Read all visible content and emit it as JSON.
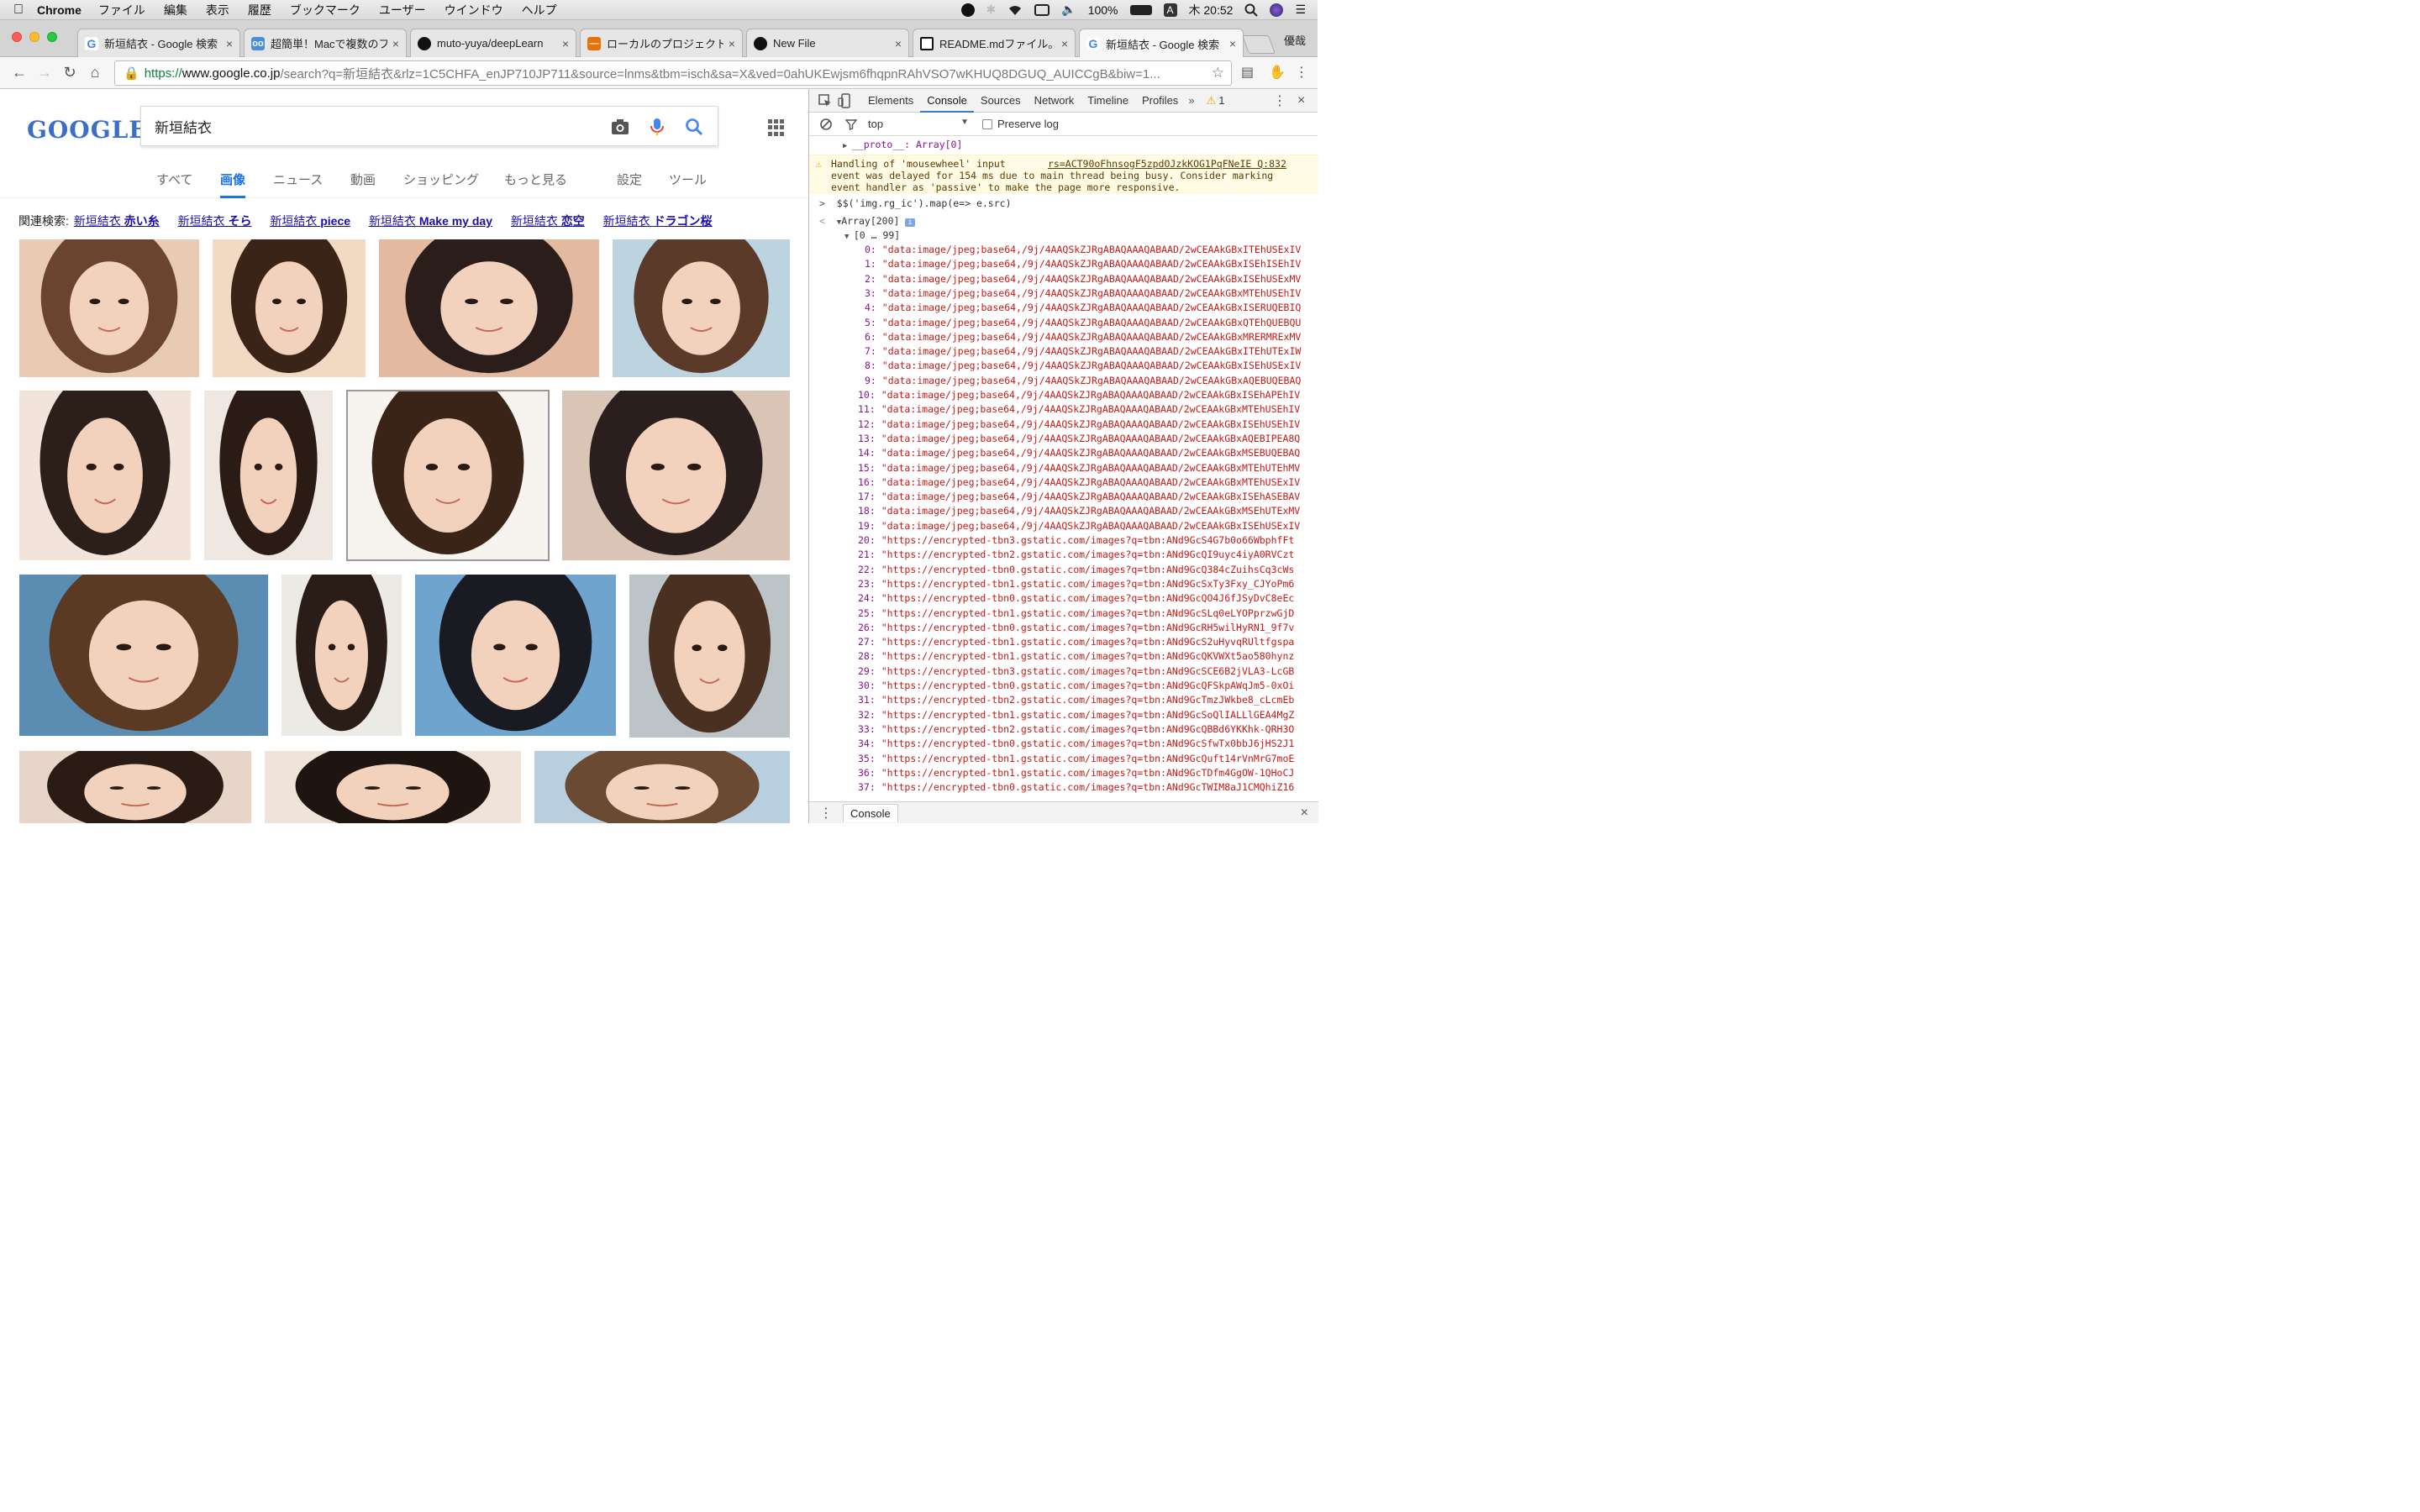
{
  "menubar": {
    "app": "Chrome",
    "items": [
      "ファイル",
      "編集",
      "表示",
      "履歴",
      "ブックマーク",
      "ユーザー",
      "ウインドウ",
      "ヘルプ"
    ],
    "battery": "100%",
    "input_method": "A",
    "clock": "木 20:52"
  },
  "tabs": [
    {
      "title": "新垣結衣 - Google 検索",
      "icon": "google-icon"
    },
    {
      "title": "超簡単！Macで複数のフ",
      "icon": "glasses-icon"
    },
    {
      "title": "muto-yuya/deepLearn",
      "icon": "github-icon"
    },
    {
      "title": "ローカルのプロジェクト",
      "icon": "qiita-icon"
    },
    {
      "title": "New File",
      "icon": "github-icon"
    },
    {
      "title": "README.mdファイル。",
      "icon": "page-icon"
    },
    {
      "title": "新垣結衣 - Google 検索",
      "icon": "google-icon"
    }
  ],
  "profile_name": "優哉",
  "address": {
    "scheme": "https://",
    "host": "www.google.co.jp",
    "path": "/search?q=新垣結衣&rlz=1C5CHFA_enJP710JP711&source=lnms&tbm=isch&sa=X&ved=0ahUKEwjsm6fhqpnRAhVSO7wKHUQ8DGUQ_AUICCgB&biw=1..."
  },
  "google": {
    "logo": "GOOGLE",
    "query": "新垣結衣",
    "tabs": [
      "すべて",
      "画像",
      "ニュース",
      "動画",
      "ショッピング",
      "もっと見る",
      "設定",
      "ツール"
    ],
    "active_tab": "画像",
    "related_label": "関連検索:",
    "related": [
      {
        "q": "新垣結衣",
        "extra": "赤い糸"
      },
      {
        "q": "新垣結衣",
        "extra": "そら"
      },
      {
        "q": "新垣結衣",
        "extra": "piece"
      },
      {
        "q": "新垣結衣",
        "extra": "Make my day"
      },
      {
        "q": "新垣結衣",
        "extra": "恋空"
      },
      {
        "q": "新垣結衣",
        "extra": "ドラゴン桜"
      }
    ]
  },
  "devtools": {
    "tabs": [
      "Elements",
      "Console",
      "Sources",
      "Network",
      "Timeline",
      "Profiles"
    ],
    "active_tab": "Console",
    "warning_count": "1",
    "context": "top",
    "preserve_log": "Preserve log",
    "proto_line": "__proto__: Array[0]",
    "warning_line1": "Handling of 'mousewheel' input",
    "warning_source": "rs=ACT90oFhnsogF5zpdOJzkKOG1PqFNeIE Q:832",
    "warning_line2": "event was delayed for 154 ms due to main thread being busy. Consider marking",
    "warning_line3": "event handler as 'passive' to make the page more responsive.",
    "command": "$$('img.rg_ic').map(e=> e.src)",
    "result": "Array[200]",
    "range": "[0 … 99]",
    "entries": [
      "\"data:image/jpeg;base64,/9j/4AAQSkZJRgABAQAAAQABAAD/2wCEAAkGBxITEhUSExIV",
      "\"data:image/jpeg;base64,/9j/4AAQSkZJRgABAQAAAQABAAD/2wCEAAkGBxISEhISEhIV",
      "\"data:image/jpeg;base64,/9j/4AAQSkZJRgABAQAAAQABAAD/2wCEAAkGBxISEhUSExMV",
      "\"data:image/jpeg;base64,/9j/4AAQSkZJRgABAQAAAQABAAD/2wCEAAkGBxMTEhUSEhIV",
      "\"data:image/jpeg;base64,/9j/4AAQSkZJRgABAQAAAQABAAD/2wCEAAkGBxISERUQEBIQ",
      "\"data:image/jpeg;base64,/9j/4AAQSkZJRgABAQAAAQABAAD/2wCEAAkGBxQTEhQUEBQU",
      "\"data:image/jpeg;base64,/9j/4AAQSkZJRgABAQAAAQABAAD/2wCEAAkGBxMRERMRExMV",
      "\"data:image/jpeg;base64,/9j/4AAQSkZJRgABAQAAAQABAAD/2wCEAAkGBxITEhUTExIW",
      "\"data:image/jpeg;base64,/9j/4AAQSkZJRgABAQAAAQABAAD/2wCEAAkGBxISEhUSExIV",
      "\"data:image/jpeg;base64,/9j/4AAQSkZJRgABAQAAAQABAAD/2wCEAAkGBxAQEBUQEBAQ",
      "\"data:image/jpeg;base64,/9j/4AAQSkZJRgABAQAAAQABAAD/2wCEAAkGBxISEhAPEhIV",
      "\"data:image/jpeg;base64,/9j/4AAQSkZJRgABAQAAAQABAAD/2wCEAAkGBxMTEhUSEhIV",
      "\"data:image/jpeg;base64,/9j/4AAQSkZJRgABAQAAAQABAAD/2wCEAAkGBxISEhUSEhIV",
      "\"data:image/jpeg;base64,/9j/4AAQSkZJRgABAQAAAQABAAD/2wCEAAkGBxAQEBIPEA8Q",
      "\"data:image/jpeg;base64,/9j/4AAQSkZJRgABAQAAAQABAAD/2wCEAAkGBxMSEBUQEBAQ",
      "\"data:image/jpeg;base64,/9j/4AAQSkZJRgABAQAAAQABAAD/2wCEAAkGBxMTEhUTEhMV",
      "\"data:image/jpeg;base64,/9j/4AAQSkZJRgABAQAAAQABAAD/2wCEAAkGBxMTEhUSExIV",
      "\"data:image/jpeg;base64,/9j/4AAQSkZJRgABAQAAAQABAAD/2wCEAAkGBxISEhASEBAV",
      "\"data:image/jpeg;base64,/9j/4AAQSkZJRgABAQAAAQABAAD/2wCEAAkGBxMSEhUTExMV",
      "\"data:image/jpeg;base64,/9j/4AAQSkZJRgABAQAAAQABAAD/2wCEAAkGBxISEhUSExIV",
      "\"https://encrypted-tbn3.gstatic.com/images?q=tbn:ANd9GcS4G7b0o66WbphfFt",
      "\"https://encrypted-tbn2.gstatic.com/images?q=tbn:ANd9GcQI9uyc4iyA0RVCzt",
      "\"https://encrypted-tbn0.gstatic.com/images?q=tbn:ANd9GcQ384cZuihsCq3cWs",
      "\"https://encrypted-tbn1.gstatic.com/images?q=tbn:ANd9GcSxTy3Fxy_CJYoPm6",
      "\"https://encrypted-tbn0.gstatic.com/images?q=tbn:ANd9GcQO4J6fJSyDvC8eEc",
      "\"https://encrypted-tbn1.gstatic.com/images?q=tbn:ANd9GcSLq0eLYOPprzwGjD",
      "\"https://encrypted-tbn0.gstatic.com/images?q=tbn:ANd9GcRH5wilHyRN1_9f7v",
      "\"https://encrypted-tbn1.gstatic.com/images?q=tbn:ANd9GcS2uHyvqRUltfgspa",
      "\"https://encrypted-tbn1.gstatic.com/images?q=tbn:ANd9GcQKVWXt5ao580hynz",
      "\"https://encrypted-tbn3.gstatic.com/images?q=tbn:ANd9GcSCE6B2jVLA3-LcGB",
      "\"https://encrypted-tbn0.gstatic.com/images?q=tbn:ANd9GcQFSkpAWqJm5-0xOi",
      "\"https://encrypted-tbn2.gstatic.com/images?q=tbn:ANd9GcTmzJWkbe8_cLcmEb",
      "\"https://encrypted-tbn1.gstatic.com/images?q=tbn:ANd9GcSoQlIALLlGEA4MgZ",
      "\"https://encrypted-tbn2.gstatic.com/images?q=tbn:ANd9GcQBBd6YKKhk-QRH3O",
      "\"https://encrypted-tbn0.gstatic.com/images?q=tbn:ANd9GcSfwTx0bbJ6jHS2J1",
      "\"https://encrypted-tbn1.gstatic.com/images?q=tbn:ANd9GcQuft14rVnMrG7moE",
      "\"https://encrypted-tbn1.gstatic.com/images?q=tbn:ANd9GcTDfm4GgOW-1QHoCJ",
      "\"https://encrypted-tbn0.gstatic.com/images?q=tbn:ANd9GcTWIM8aJ1CMQhiZ16"
    ],
    "drawer_tab": "Console"
  }
}
